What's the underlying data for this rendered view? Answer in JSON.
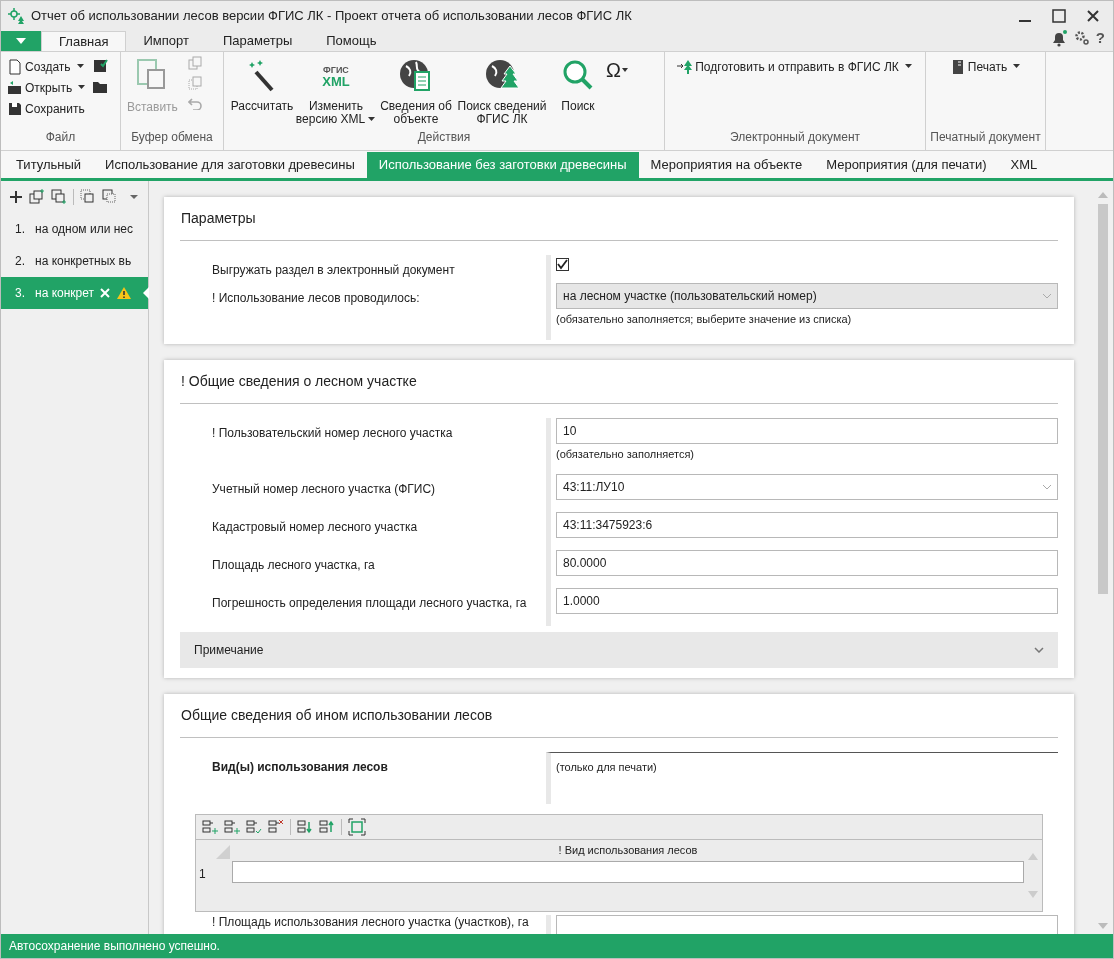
{
  "window": {
    "title": "Отчет об использовании лесов версии ФГИС ЛК - Проект отчета об использовании лесов ФГИС ЛК",
    "help": "?"
  },
  "ribbon_tabs": [
    {
      "label": "Главная",
      "selected": true
    },
    {
      "label": "Импорт",
      "selected": false
    },
    {
      "label": "Параметры",
      "selected": false
    },
    {
      "label": "Помощь",
      "selected": false
    }
  ],
  "ribbon": {
    "file": {
      "caption": "Файл",
      "create": "Создать",
      "open": "Открыть",
      "save": "Сохранить"
    },
    "clipboard": {
      "caption": "Буфер обмена",
      "paste": "Вставить",
      "paste_disabled": true
    },
    "actions": {
      "caption": "Действия",
      "calculate": "Рассчитать",
      "xml_icon_top": "ФГИС",
      "xml_icon_bottom": "XML",
      "change_xml_line1": "Изменить",
      "change_xml_line2": "версию XML",
      "object_line1": "Сведения об",
      "object_line2": "объекте",
      "fgis_line1": "Поиск сведений",
      "fgis_line2": "ФГИС ЛК",
      "search": "Поиск",
      "symbol": "Ω"
    },
    "edoc": {
      "caption": "Электронный документ",
      "send": "Подготовить и отправить в ФГИС ЛК"
    },
    "print": {
      "caption": "Печатный документ",
      "print": "Печать"
    }
  },
  "doc_tabs": [
    {
      "label": "Титульный",
      "selected": false
    },
    {
      "label": "Использование для заготовки древесины",
      "selected": false
    },
    {
      "label": "Использование без заготовки древесины",
      "selected": true
    },
    {
      "label": "Мероприятия на объекте",
      "selected": false
    },
    {
      "label": "Мероприятия (для печати)",
      "selected": false
    },
    {
      "label": "XML",
      "selected": false
    }
  ],
  "sidebar": {
    "items": [
      {
        "number": "1.",
        "label": "на одном или нес",
        "selected": false,
        "warning": false
      },
      {
        "number": "2.",
        "label": "на конкретных вь",
        "selected": false,
        "warning": false
      },
      {
        "number": "3.",
        "label": "на конкрет",
        "selected": true,
        "warning": true
      }
    ]
  },
  "sections": [
    {
      "title": "Параметры",
      "rows": [
        {
          "kind": "checkbox",
          "label": "Выгружать раздел в электронный документ",
          "checked": true
        },
        {
          "kind": "select",
          "label": "! Использование лесов проводилось:",
          "value": "на лесном участке (пользовательский номер)",
          "hint": "(обязательно заполняется; выберите значение из списка)",
          "disabled": true
        }
      ]
    },
    {
      "title": "! Общие сведения о лесном участке",
      "rows": [
        {
          "kind": "input",
          "label": "! Пользовательский номер лесного участка",
          "value": "10",
          "hint": "(обязательно заполняется)"
        },
        {
          "kind": "select",
          "label": "Учетный номер лесного участка (ФГИС)",
          "value": "43:11:ЛУ10",
          "disabled": false
        },
        {
          "kind": "input",
          "label": "Кадастровый номер лесного участка",
          "value": "43:11:3475923:6"
        },
        {
          "kind": "input",
          "label": "Площадь лесного участка, га",
          "value": "80.0000"
        },
        {
          "kind": "input",
          "label": "Погрешность определения площади лесного участка, га",
          "value": "1.0000"
        }
      ],
      "collapsible": {
        "label": "Примечание",
        "expanded": false
      }
    },
    {
      "title": "Общие сведения об ином использовании лесов",
      "rows": [
        {
          "kind": "note",
          "label": "Вид(ы) использования лесов",
          "value": "(только для печати)"
        }
      ],
      "grid": {
        "column": "! Вид использования лесов",
        "rows": [
          {
            "number": "1",
            "value": ""
          }
        ]
      },
      "cut_label": "! Площадь использования лесного участка (участков), га"
    }
  ],
  "status_bar": "Автосохранение выполнено успешно."
}
